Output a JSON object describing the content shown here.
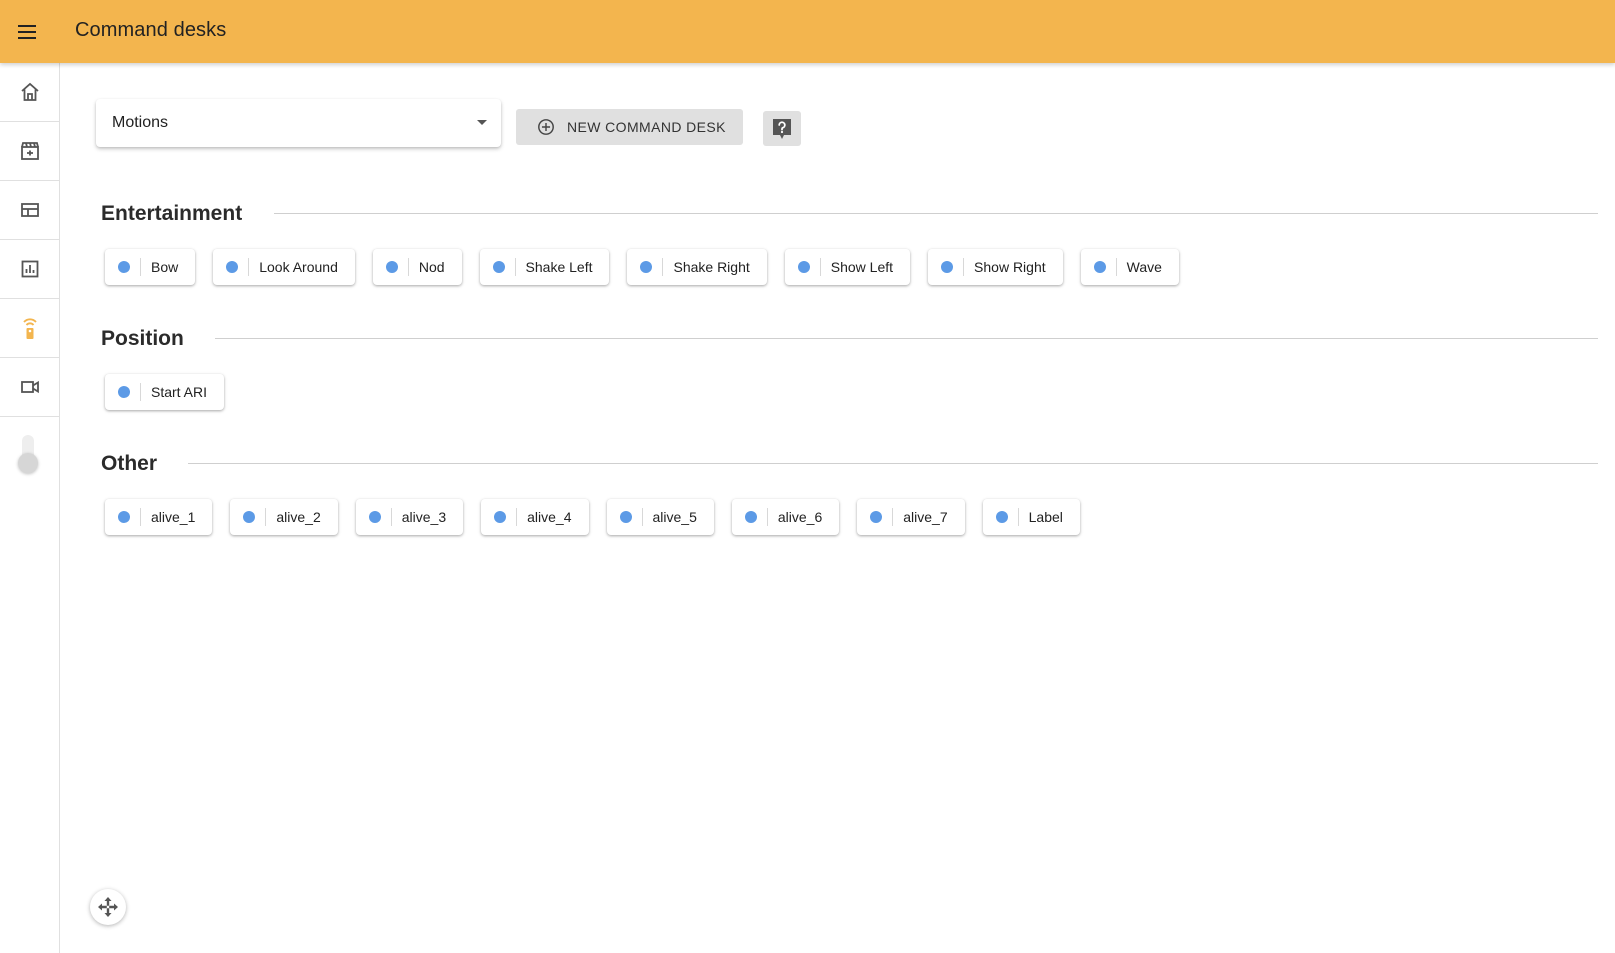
{
  "header": {
    "title": "Command desks",
    "menu_icon": "menu-icon"
  },
  "sidebar": {
    "items": [
      {
        "name": "home",
        "icon": "home-icon"
      },
      {
        "name": "movie",
        "icon": "clapperboard-icon"
      },
      {
        "name": "layout",
        "icon": "table-layout-icon"
      },
      {
        "name": "stats",
        "icon": "bar-chart-icon"
      },
      {
        "name": "remote",
        "icon": "remote-control-icon",
        "active": true
      },
      {
        "name": "video",
        "icon": "video-camera-icon"
      }
    ],
    "accent_color": "#f3b54e"
  },
  "toolbar": {
    "desk_select_value": "Motions",
    "new_desk_label": "NEW COMMAND DESK",
    "help_icon": "help-icon"
  },
  "sections": [
    {
      "title": "Entertainment",
      "chips": [
        "Bow",
        "Look Around",
        "Nod",
        "Shake Left",
        "Shake Right",
        "Show Left",
        "Show Right",
        "Wave"
      ]
    },
    {
      "title": "Position",
      "chips": [
        "Start ARI"
      ]
    },
    {
      "title": "Other",
      "chips": [
        "alive_1",
        "alive_2",
        "alive_3",
        "alive_4",
        "alive_5",
        "alive_6",
        "alive_7",
        "Label"
      ]
    }
  ],
  "colors": {
    "header_bg": "#f3b54e",
    "chip_dot": "#5c9ae6"
  }
}
